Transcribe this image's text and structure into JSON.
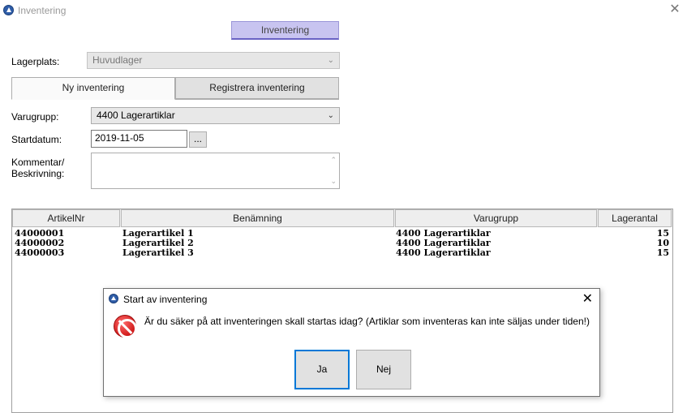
{
  "window": {
    "title": "Inventering"
  },
  "top_tab": {
    "label": "Inventering"
  },
  "form": {
    "lagerplats_label": "Lagerplats:",
    "lagerplats_value": "Huvudlager",
    "tabs": [
      {
        "label": "Ny inventering",
        "active": true
      },
      {
        "label": "Registrera inventering",
        "active": false
      }
    ],
    "varugrupp_label": "Varugrupp:",
    "varugrupp_value": "4400 Lagerartiklar",
    "startdatum_label": "Startdatum:",
    "startdatum_value": "2019-11-05",
    "dots_label": "...",
    "kommentar_label_1": "Kommentar/",
    "kommentar_label_2": "Beskrivning:",
    "kommentar_value": ""
  },
  "grid": {
    "headers": [
      "ArtikelNr",
      "Benämning",
      "Varugrupp",
      "Lagerantal"
    ],
    "rows": [
      {
        "artikelnr": "44000001",
        "benamning": "Lagerartikel 1",
        "varugrupp": "4400 Lagerartiklar",
        "lagerantal": "15"
      },
      {
        "artikelnr": "44000002",
        "benamning": "Lagerartikel 2",
        "varugrupp": "4400 Lagerartiklar",
        "lagerantal": "10"
      },
      {
        "artikelnr": "44000003",
        "benamning": "Lagerartikel 3",
        "varugrupp": "4400 Lagerartiklar",
        "lagerantal": "15"
      }
    ]
  },
  "dialog": {
    "title": "Start av inventering",
    "message": "Är du säker på att inventeringen skall startas idag? (Artiklar som inventeras kan inte säljas under tiden!)",
    "yes_label": "Ja",
    "no_label": "Nej"
  },
  "icons": {
    "app": "app-logo-icon",
    "close": "close-icon",
    "dropdown": "chevron-down-icon",
    "stop": "stop-error-icon"
  }
}
